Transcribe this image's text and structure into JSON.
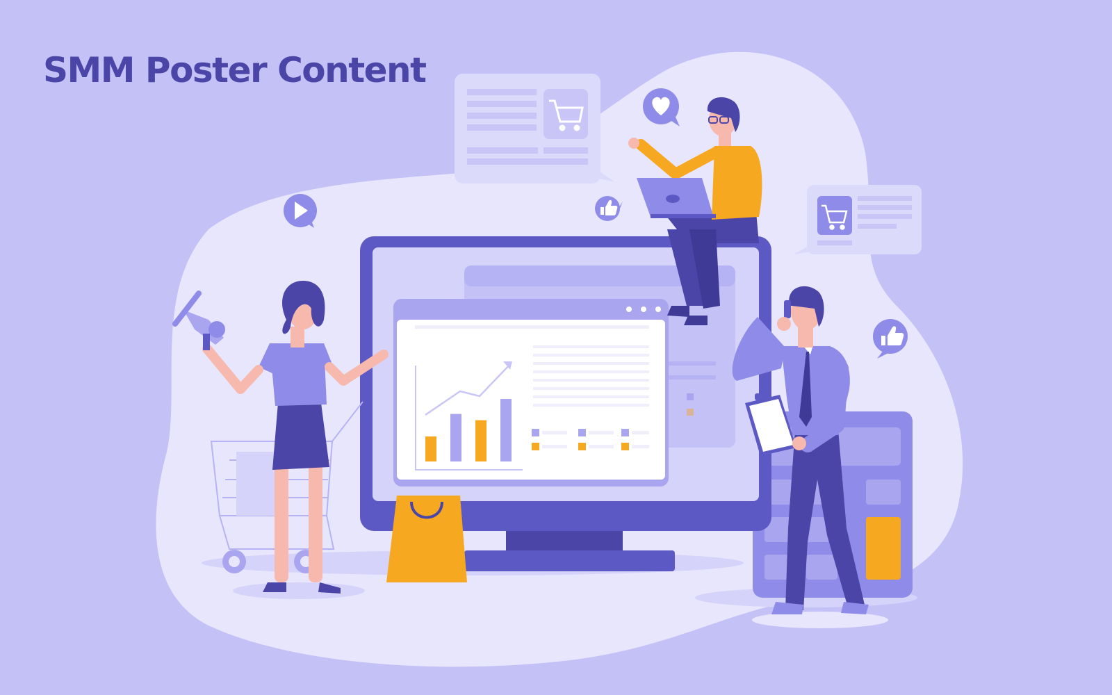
{
  "poster": {
    "title": "SMM Poster Content"
  },
  "palette": {
    "background": "#c4c1f7",
    "blob": "#e8e6fd",
    "accent_dark": "#4a45a7",
    "accent_purple": "#5c58c4",
    "accent_orange": "#f6a821",
    "skin": "#f7b9ad"
  },
  "illustration": {
    "chart_bars": [
      1.0,
      1.9,
      1.65,
      2.5
    ],
    "chart_bar_colors": [
      "#f6a821",
      "#a9a6ef",
      "#f6a821",
      "#a9a6ef"
    ],
    "icons": [
      "play-icon",
      "heart-icon",
      "thumbs-up-icon",
      "shopping-cart-icon",
      "megaphone-icon",
      "shopping-bag-icon",
      "calculator-icon",
      "laptop-icon",
      "clipboard-icon",
      "phone-icon"
    ]
  }
}
